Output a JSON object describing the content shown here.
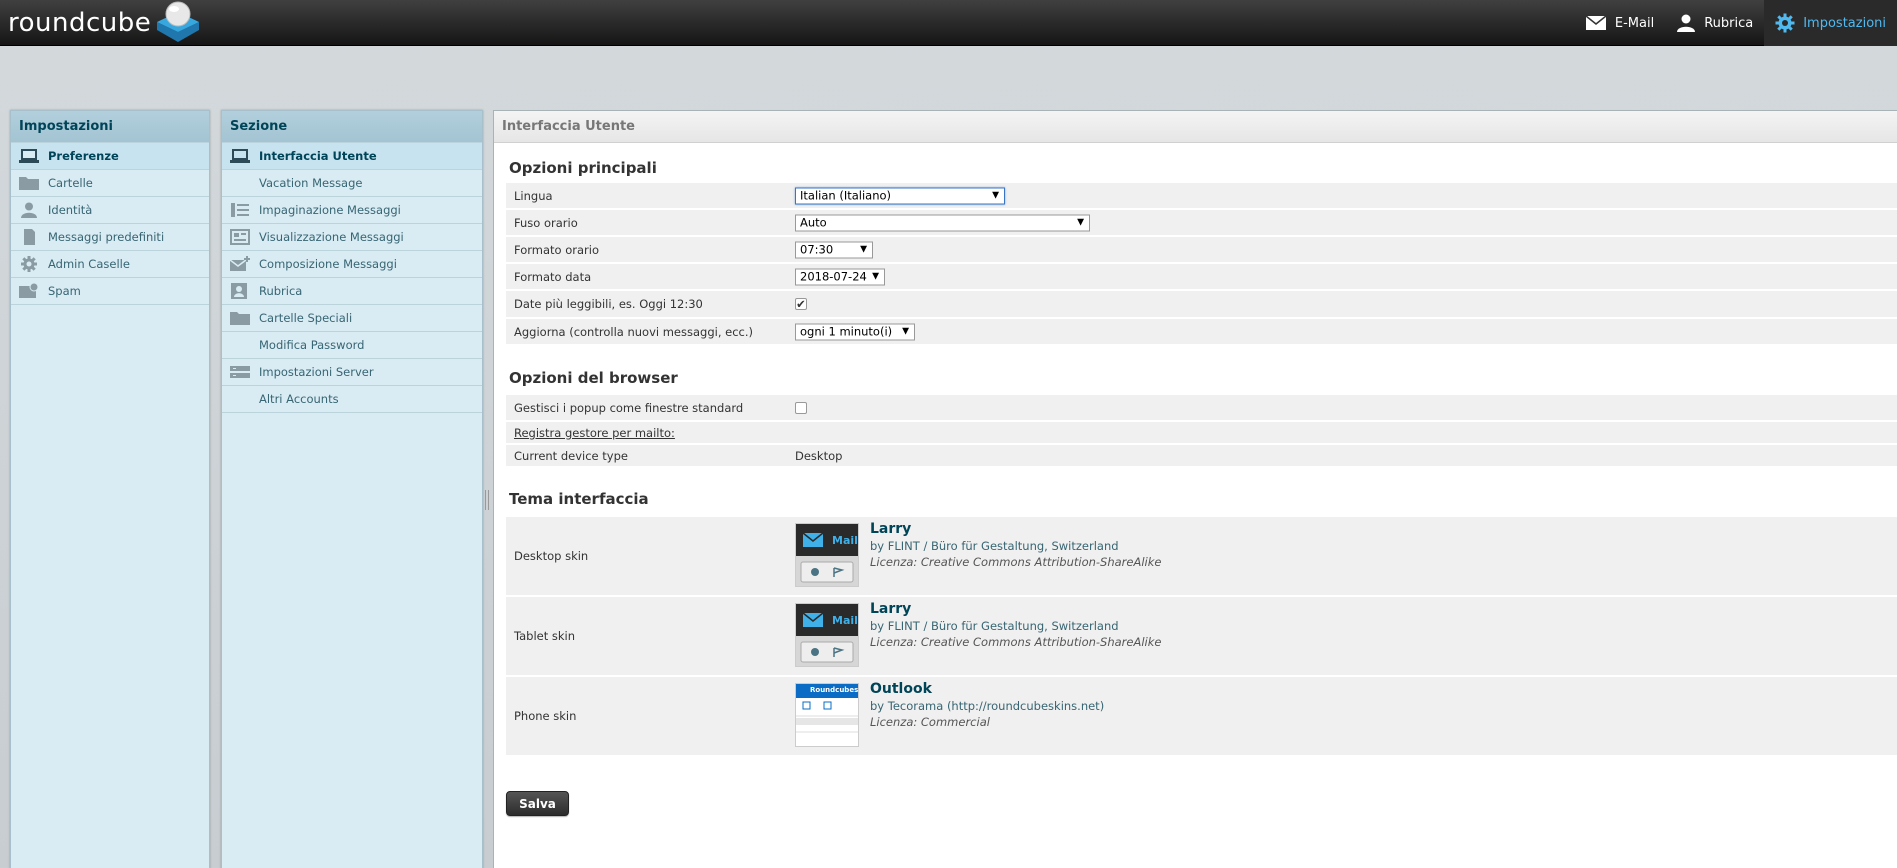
{
  "app": {
    "logo_text": "roundcube"
  },
  "topnav": [
    {
      "label": "E-Mail",
      "icon": "envelope-icon"
    },
    {
      "label": "Rubrica",
      "icon": "person-icon"
    },
    {
      "label": "Impostazioni",
      "icon": "gear-icon",
      "selected": true
    }
  ],
  "settings_panel": {
    "title": "Impostazioni",
    "items": [
      {
        "label": "Preferenze",
        "icon": "monitor-icon",
        "selected": true
      },
      {
        "label": "Cartelle",
        "icon": "folder-icon"
      },
      {
        "label": "Identità",
        "icon": "person-icon"
      },
      {
        "label": "Messaggi predefiniti",
        "icon": "document-icon"
      },
      {
        "label": "Admin Caselle",
        "icon": "gear-icon"
      },
      {
        "label": "Spam",
        "icon": "spam-icon"
      }
    ]
  },
  "section_panel": {
    "title": "Sezione",
    "items": [
      {
        "label": "Interfaccia Utente",
        "icon": "monitor-icon",
        "selected": true
      },
      {
        "label": "Vacation Message",
        "icon": ""
      },
      {
        "label": "Impaginazione Messaggi",
        "icon": "list-layout-icon"
      },
      {
        "label": "Visualizzazione Messaggi",
        "icon": "message-view-icon"
      },
      {
        "label": "Composizione Messaggi",
        "icon": "compose-icon"
      },
      {
        "label": "Rubrica",
        "icon": "addressbook-icon"
      },
      {
        "label": "Cartelle Speciali",
        "icon": "folder-icon"
      },
      {
        "label": "Modifica Password",
        "icon": ""
      },
      {
        "label": "Impostazioni Server",
        "icon": "server-icon"
      },
      {
        "label": "Altri Accounts",
        "icon": ""
      }
    ]
  },
  "content": {
    "header": "Interfaccia Utente",
    "main_options": {
      "title": "Opzioni principali",
      "rows": [
        {
          "label": "Lingua",
          "value": "Italian (Italiano)"
        },
        {
          "label": "Fuso orario",
          "value": "Auto"
        },
        {
          "label": "Formato orario",
          "value": "07:30"
        },
        {
          "label": "Formato data",
          "value": "2018-07-24"
        },
        {
          "label": "Date più leggibili, es. Oggi 12:30",
          "checked": true
        },
        {
          "label": "Aggiorna (controlla nuovi messaggi, ecc.)",
          "value": "ogni 1 minuto(i)"
        }
      ]
    },
    "browser_options": {
      "title": "Opzioni del browser",
      "popup_label": "Gestisci i popup come finestre standard",
      "popup_checked": false,
      "mailto_link": "Registra gestore per mailto:",
      "device_label": "Current device type",
      "device_value": "Desktop"
    },
    "theme": {
      "title": "Tema interfaccia",
      "skins": [
        {
          "label": "Desktop skin",
          "name": "Larry",
          "author": "by FLINT / Büro für Gestaltung, Switzerland",
          "license": "Licenza: Creative Commons Attribution-ShareAlike",
          "thumb_text": "Mail"
        },
        {
          "label": "Tablet skin",
          "name": "Larry",
          "author": "by FLINT / Büro für Gestaltung, Switzerland",
          "license": "Licenza: Creative Commons Attribution-ShareAlike",
          "thumb_text": "Mail"
        },
        {
          "label": "Phone skin",
          "name": "Outlook",
          "author": "by Tecorama (http://roundcubeskins.net)",
          "license": "Licenza: Commercial",
          "thumb_text": "Roundcubeskins"
        }
      ]
    },
    "save_label": "Salva"
  }
}
